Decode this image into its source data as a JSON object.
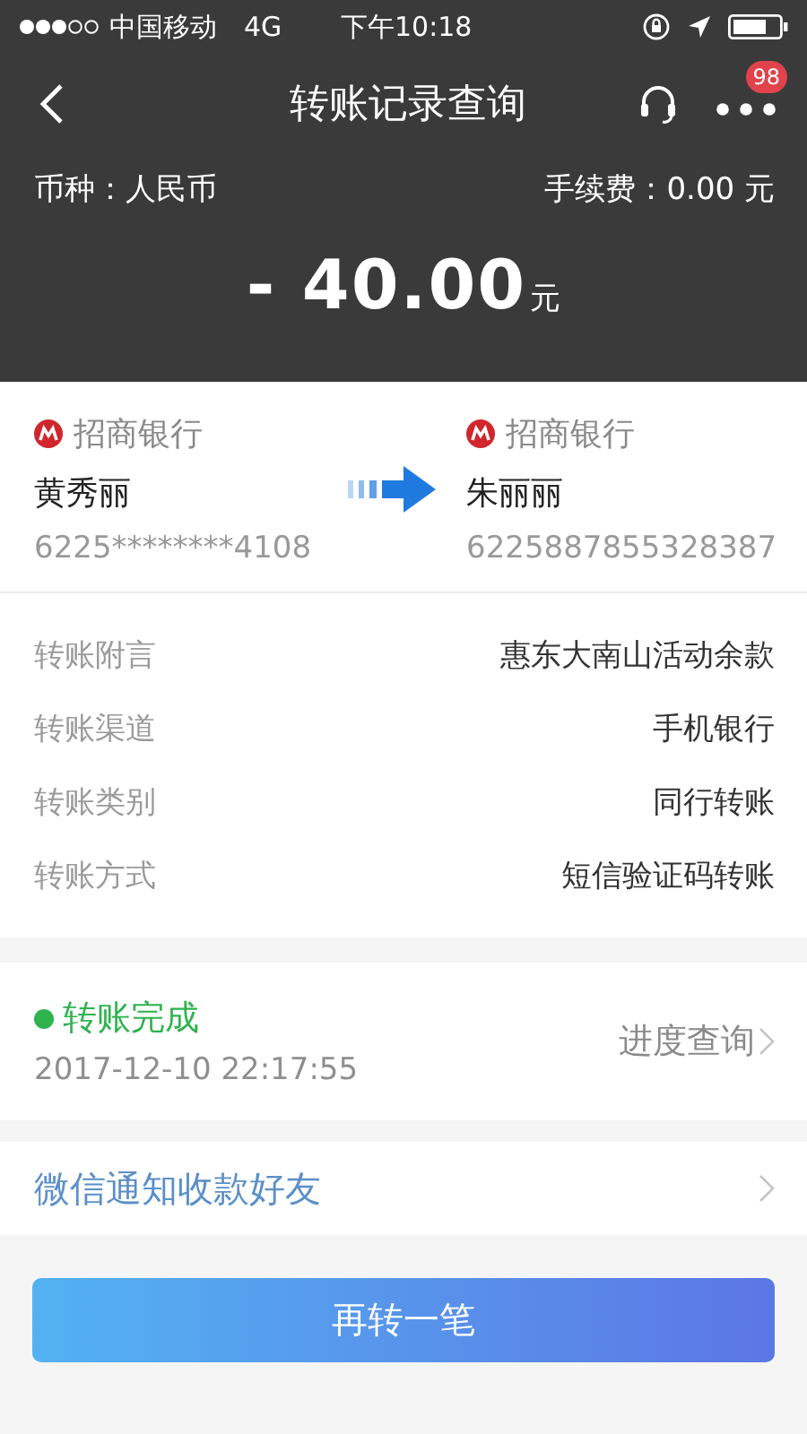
{
  "status_bar": {
    "carrier": "中国移动",
    "network": "4G",
    "time": "下午10:18"
  },
  "nav": {
    "title": "转账记录查询",
    "badge": "98"
  },
  "summary": {
    "currency_label": "币种：人民币",
    "fee_label": "手续费：0.00 元",
    "amount": "- 40.00",
    "amount_unit": "元"
  },
  "payer": {
    "bank": "招商银行",
    "name": "黄秀丽",
    "account": "6225********4108"
  },
  "payee": {
    "bank": "招商银行",
    "name": "朱丽丽",
    "account": "6225887855328387"
  },
  "details": [
    {
      "label": "转账附言",
      "value": "惠东大南山活动余款"
    },
    {
      "label": "转账渠道",
      "value": "手机银行"
    },
    {
      "label": "转账类别",
      "value": "同行转账"
    },
    {
      "label": "转账方式",
      "value": "短信验证码转账"
    }
  ],
  "status": {
    "label": "转账完成",
    "time": "2017-12-10 22:17:55",
    "link": "进度查询"
  },
  "notify": {
    "label": "微信通知收款好友"
  },
  "button": {
    "label": "再转一笔"
  }
}
